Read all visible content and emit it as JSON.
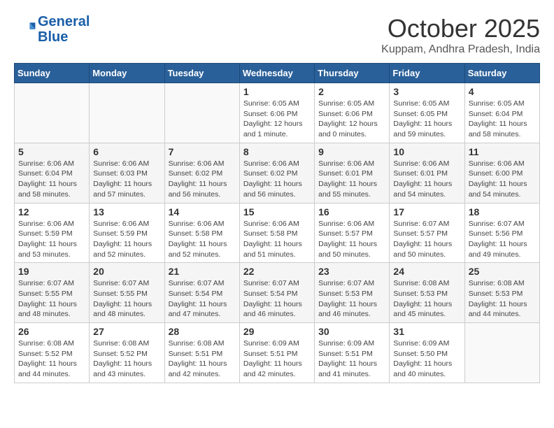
{
  "header": {
    "logo_line1": "General",
    "logo_line2": "Blue",
    "month": "October 2025",
    "location": "Kuppam, Andhra Pradesh, India"
  },
  "weekdays": [
    "Sunday",
    "Monday",
    "Tuesday",
    "Wednesday",
    "Thursday",
    "Friday",
    "Saturday"
  ],
  "weeks": [
    [
      {
        "day": "",
        "info": ""
      },
      {
        "day": "",
        "info": ""
      },
      {
        "day": "",
        "info": ""
      },
      {
        "day": "1",
        "info": "Sunrise: 6:05 AM\nSunset: 6:06 PM\nDaylight: 12 hours\nand 1 minute."
      },
      {
        "day": "2",
        "info": "Sunrise: 6:05 AM\nSunset: 6:06 PM\nDaylight: 12 hours\nand 0 minutes."
      },
      {
        "day": "3",
        "info": "Sunrise: 6:05 AM\nSunset: 6:05 PM\nDaylight: 11 hours\nand 59 minutes."
      },
      {
        "day": "4",
        "info": "Sunrise: 6:05 AM\nSunset: 6:04 PM\nDaylight: 11 hours\nand 58 minutes."
      }
    ],
    [
      {
        "day": "5",
        "info": "Sunrise: 6:06 AM\nSunset: 6:04 PM\nDaylight: 11 hours\nand 58 minutes."
      },
      {
        "day": "6",
        "info": "Sunrise: 6:06 AM\nSunset: 6:03 PM\nDaylight: 11 hours\nand 57 minutes."
      },
      {
        "day": "7",
        "info": "Sunrise: 6:06 AM\nSunset: 6:02 PM\nDaylight: 11 hours\nand 56 minutes."
      },
      {
        "day": "8",
        "info": "Sunrise: 6:06 AM\nSunset: 6:02 PM\nDaylight: 11 hours\nand 56 minutes."
      },
      {
        "day": "9",
        "info": "Sunrise: 6:06 AM\nSunset: 6:01 PM\nDaylight: 11 hours\nand 55 minutes."
      },
      {
        "day": "10",
        "info": "Sunrise: 6:06 AM\nSunset: 6:01 PM\nDaylight: 11 hours\nand 54 minutes."
      },
      {
        "day": "11",
        "info": "Sunrise: 6:06 AM\nSunset: 6:00 PM\nDaylight: 11 hours\nand 54 minutes."
      }
    ],
    [
      {
        "day": "12",
        "info": "Sunrise: 6:06 AM\nSunset: 5:59 PM\nDaylight: 11 hours\nand 53 minutes."
      },
      {
        "day": "13",
        "info": "Sunrise: 6:06 AM\nSunset: 5:59 PM\nDaylight: 11 hours\nand 52 minutes."
      },
      {
        "day": "14",
        "info": "Sunrise: 6:06 AM\nSunset: 5:58 PM\nDaylight: 11 hours\nand 52 minutes."
      },
      {
        "day": "15",
        "info": "Sunrise: 6:06 AM\nSunset: 5:58 PM\nDaylight: 11 hours\nand 51 minutes."
      },
      {
        "day": "16",
        "info": "Sunrise: 6:06 AM\nSunset: 5:57 PM\nDaylight: 11 hours\nand 50 minutes."
      },
      {
        "day": "17",
        "info": "Sunrise: 6:07 AM\nSunset: 5:57 PM\nDaylight: 11 hours\nand 50 minutes."
      },
      {
        "day": "18",
        "info": "Sunrise: 6:07 AM\nSunset: 5:56 PM\nDaylight: 11 hours\nand 49 minutes."
      }
    ],
    [
      {
        "day": "19",
        "info": "Sunrise: 6:07 AM\nSunset: 5:55 PM\nDaylight: 11 hours\nand 48 minutes."
      },
      {
        "day": "20",
        "info": "Sunrise: 6:07 AM\nSunset: 5:55 PM\nDaylight: 11 hours\nand 48 minutes."
      },
      {
        "day": "21",
        "info": "Sunrise: 6:07 AM\nSunset: 5:54 PM\nDaylight: 11 hours\nand 47 minutes."
      },
      {
        "day": "22",
        "info": "Sunrise: 6:07 AM\nSunset: 5:54 PM\nDaylight: 11 hours\nand 46 minutes."
      },
      {
        "day": "23",
        "info": "Sunrise: 6:07 AM\nSunset: 5:53 PM\nDaylight: 11 hours\nand 46 minutes."
      },
      {
        "day": "24",
        "info": "Sunrise: 6:08 AM\nSunset: 5:53 PM\nDaylight: 11 hours\nand 45 minutes."
      },
      {
        "day": "25",
        "info": "Sunrise: 6:08 AM\nSunset: 5:53 PM\nDaylight: 11 hours\nand 44 minutes."
      }
    ],
    [
      {
        "day": "26",
        "info": "Sunrise: 6:08 AM\nSunset: 5:52 PM\nDaylight: 11 hours\nand 44 minutes."
      },
      {
        "day": "27",
        "info": "Sunrise: 6:08 AM\nSunset: 5:52 PM\nDaylight: 11 hours\nand 43 minutes."
      },
      {
        "day": "28",
        "info": "Sunrise: 6:08 AM\nSunset: 5:51 PM\nDaylight: 11 hours\nand 42 minutes."
      },
      {
        "day": "29",
        "info": "Sunrise: 6:09 AM\nSunset: 5:51 PM\nDaylight: 11 hours\nand 42 minutes."
      },
      {
        "day": "30",
        "info": "Sunrise: 6:09 AM\nSunset: 5:51 PM\nDaylight: 11 hours\nand 41 minutes."
      },
      {
        "day": "31",
        "info": "Sunrise: 6:09 AM\nSunset: 5:50 PM\nDaylight: 11 hours\nand 40 minutes."
      },
      {
        "day": "",
        "info": ""
      }
    ]
  ]
}
